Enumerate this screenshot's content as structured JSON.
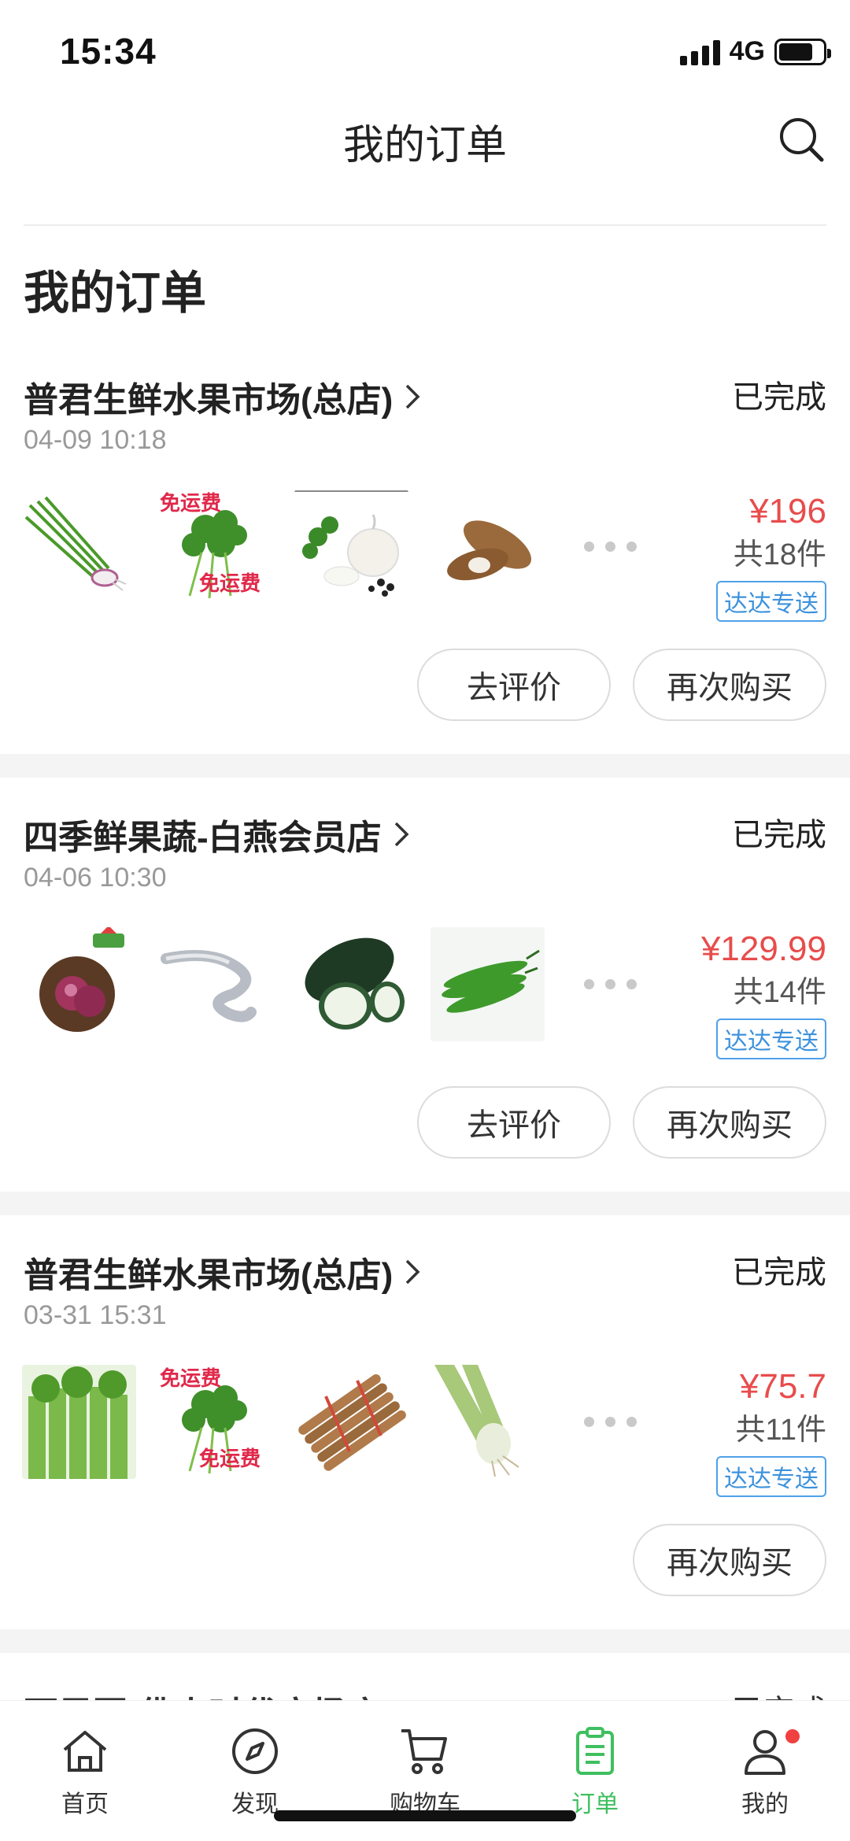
{
  "status_bar": {
    "time": "15:34",
    "network": "4G",
    "battery_level": 0.78
  },
  "header": {
    "title": "我的订单"
  },
  "section": {
    "title": "我的订单"
  },
  "orders": [
    {
      "store": "普君生鲜水果市场(总店)",
      "status": "已完成",
      "date": "04-09 10:18",
      "price": "¥196",
      "count": "共18件",
      "delivery": "达达专送",
      "promo_text": "免运费",
      "items": [
        "green-onion",
        "cilantro",
        "garlic",
        "yam"
      ],
      "buttons": [
        "去评价",
        "再次购买"
      ]
    },
    {
      "store": "四季鲜果蔬-白燕会员店",
      "status": "已完成",
      "date": "04-06 10:30",
      "price": "¥129.99",
      "count": "共14件",
      "delivery": "达达专送",
      "items": [
        "red-onion",
        "eel",
        "winter-melon",
        "green-pepper"
      ],
      "buttons": [
        "去评价",
        "再次购买"
      ]
    },
    {
      "store": "普君生鲜水果市场(总店)",
      "status": "已完成",
      "date": "03-31 15:31",
      "price": "¥75.7",
      "count": "共11件",
      "delivery": "达达专送",
      "promo_text": "免运费",
      "items": [
        "celery",
        "cilantro",
        "burdock",
        "leek-root"
      ],
      "buttons": [
        "再次购买"
      ]
    }
  ],
  "peek": {
    "store": "百果园(佛山时代广场店)",
    "status": "已完成"
  },
  "tabs": [
    {
      "label": "首页",
      "icon": "home-icon",
      "active": false
    },
    {
      "label": "发现",
      "icon": "compass-icon",
      "active": false
    },
    {
      "label": "购物车",
      "icon": "cart-icon",
      "active": false
    },
    {
      "label": "订单",
      "icon": "order-clipboard-icon",
      "active": true
    },
    {
      "label": "我的",
      "icon": "profile-icon",
      "active": false,
      "badge": true
    }
  ],
  "colors": {
    "accent_green": "#3fbf5f",
    "price_red": "#e84c4c",
    "tag_blue": "#3d92dd",
    "badge_red": "#f04040"
  }
}
